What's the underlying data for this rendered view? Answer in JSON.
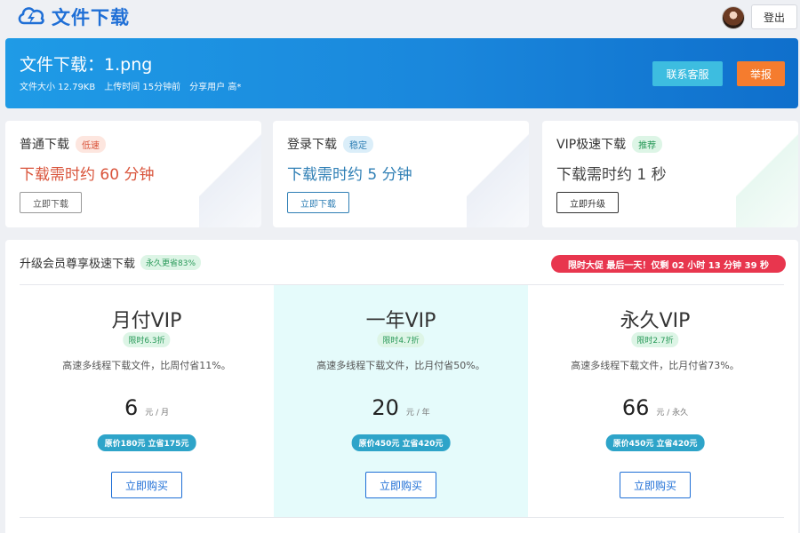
{
  "colors": {
    "brand": "#1f6fd6",
    "banner": "#1a87dc",
    "contact_button": "#3dbde0",
    "report_button": "#f57c2e",
    "slow": "#d9533a",
    "stable": "#2f7fb5",
    "promo": "#e8364e",
    "highlight_plan": "#e5fbfb"
  },
  "topbar": {
    "brand_icon": "cloud-lightning-icon",
    "brand_title": "文件下载",
    "logout_label": "登出"
  },
  "banner": {
    "title": "文件下载：1.png",
    "size": "文件大小 12.79KB",
    "upload_time": "上传时间 15分钟前",
    "sharer": "分享用户 高*",
    "contact_label": "联系客服",
    "report_label": "举报"
  },
  "download_options": [
    {
      "name": "普通下载",
      "tag": "低速",
      "time": "下载需时约 60 分钟",
      "button": "立即下载"
    },
    {
      "name": "登录下载",
      "tag": "稳定",
      "time": "下载需时约 5 分钟",
      "button": "立即下载"
    },
    {
      "name": "VIP极速下载",
      "tag": "推荐",
      "time": "下载需时约 1 秒",
      "button": "立即升级"
    }
  ],
  "vip": {
    "title": "升级会员尊享极速下载",
    "tag": "永久更省83%",
    "promo": "限时大促 最后一天！仅剩 02 小时 13 分钟 39 秒",
    "plans": [
      {
        "name": "月付VIP",
        "discount": "限时6.3折",
        "desc": "高速多线程下载文件，比周付省11%。",
        "price": "6",
        "unit": "元 / 月",
        "original": "原价180元 立省175元",
        "buy": "立即购买"
      },
      {
        "name": "一年VIP",
        "discount": "限时4.7折",
        "desc": "高速多线程下载文件，比月付省50%。",
        "price": "20",
        "unit": "元 / 年",
        "original": "原价450元 立省420元",
        "buy": "立即购买"
      },
      {
        "name": "永久VIP",
        "discount": "限时2.7折",
        "desc": "高速多线程下载文件，比月付省73%。",
        "price": "66",
        "unit": "元 / 永久",
        "original": "原价450元 立省420元",
        "buy": "立即购买"
      }
    ]
  }
}
